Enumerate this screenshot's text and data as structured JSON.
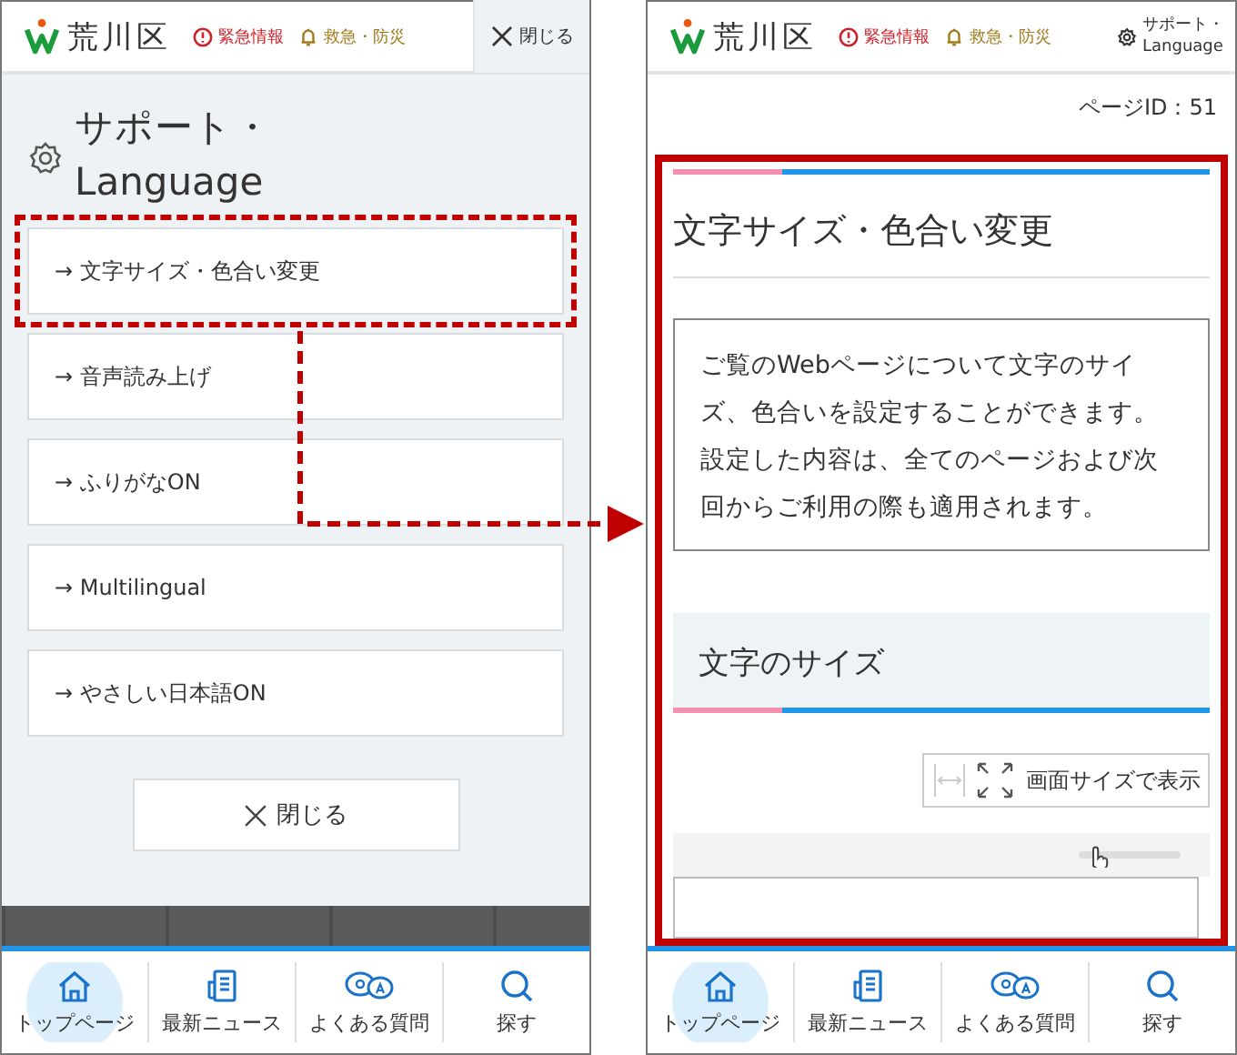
{
  "left_screen": {
    "header": {
      "logo_text": "荒川区",
      "links": [
        {
          "kind": "alert",
          "label": "緊急情報"
        },
        {
          "kind": "bell",
          "label": "救急・防災"
        }
      ],
      "close_tab": "閉じる"
    },
    "menu_title_lines": [
      "サポート・",
      "Language"
    ],
    "menu_items": [
      {
        "label": "→ 文字サイズ・色合い変更",
        "highlighted": true
      },
      {
        "label": "→ 音声読み上げ",
        "highlighted": false
      },
      {
        "label": "→ ふりがなON",
        "highlighted": false
      },
      {
        "label": "→ Multilingual",
        "highlighted": false
      },
      {
        "label": "→ やさしい日本語ON",
        "highlighted": false
      }
    ],
    "close_button": "閉じる",
    "bottom_nav": [
      {
        "kind": "home",
        "label": "トップページ",
        "selected": true
      },
      {
        "kind": "news",
        "label": "最新ニュース",
        "selected": false
      },
      {
        "kind": "qa",
        "label": "よくある質問",
        "selected": false
      },
      {
        "kind": "search",
        "label": "探す",
        "selected": false
      }
    ]
  },
  "right_screen": {
    "header": {
      "logo_text": "荒川区",
      "links": [
        {
          "kind": "alert",
          "label": "緊急情報"
        },
        {
          "kind": "bell",
          "label": "救急・防災"
        }
      ],
      "support_lines": [
        "サポート・",
        "Language"
      ]
    },
    "page_id": "ページID：51",
    "page_title": "文字サイズ・色合い変更",
    "intro": "ご覧のWebページについて文字のサイズ、色合いを設定することができます。設定した内容は、全てのページおよび次回からご利用の際も適用されます。",
    "section_title": "文字のサイズ",
    "fit_button": "画面サイズで表示",
    "bottom_nav": [
      {
        "kind": "home",
        "label": "トップページ",
        "selected": true
      },
      {
        "kind": "news",
        "label": "最新ニュース",
        "selected": false
      },
      {
        "kind": "qa",
        "label": "よくある質問",
        "selected": false
      },
      {
        "kind": "search",
        "label": "探す",
        "selected": false
      }
    ]
  }
}
